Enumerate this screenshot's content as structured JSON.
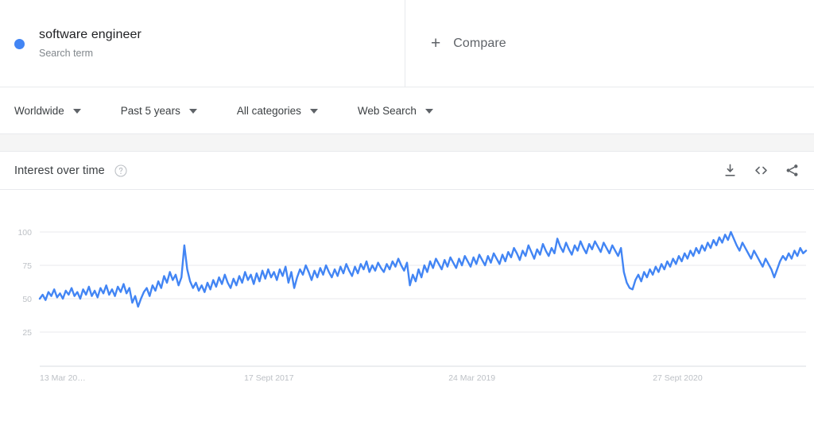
{
  "header": {
    "term": {
      "label": "software engineer",
      "sublabel": "Search term",
      "color": "#4285f4"
    },
    "compare": {
      "label": "Compare",
      "plus": "+"
    }
  },
  "filters": [
    {
      "label": "Worldwide"
    },
    {
      "label": "Past 5 years"
    },
    {
      "label": "All categories"
    },
    {
      "label": "Web Search"
    }
  ],
  "card": {
    "title": "Interest over time",
    "help_icon": "help-circle-icon",
    "actions": [
      {
        "name": "download-icon"
      },
      {
        "name": "embed-icon"
      },
      {
        "name": "share-icon"
      }
    ]
  },
  "chart_data": {
    "type": "line",
    "title": "Interest over time",
    "xlabel": "",
    "ylabel": "",
    "ylim": [
      0,
      100
    ],
    "yticks": [
      100,
      75,
      50,
      25
    ],
    "grid": true,
    "legend": [
      "software engineer"
    ],
    "legend_position": "top-left",
    "line_color": "#4285f4",
    "xtick_labels": [
      "13 Mar 20…",
      "17 Sept 2017",
      "24 Mar 2019",
      "27 Sept 2020"
    ],
    "xtick_positions": [
      0,
      0.2667,
      0.5334,
      0.8
    ],
    "series": [
      {
        "name": "software engineer",
        "values": [
          50,
          53,
          49,
          55,
          52,
          57,
          51,
          54,
          50,
          56,
          53,
          58,
          52,
          55,
          50,
          57,
          53,
          59,
          52,
          56,
          51,
          58,
          54,
          60,
          53,
          57,
          52,
          59,
          55,
          61,
          54,
          58,
          47,
          52,
          44,
          50,
          55,
          58,
          52,
          60,
          56,
          63,
          58,
          67,
          62,
          70,
          64,
          68,
          60,
          66,
          90,
          72,
          63,
          58,
          62,
          56,
          60,
          55,
          62,
          57,
          64,
          59,
          66,
          61,
          68,
          62,
          58,
          65,
          60,
          67,
          62,
          70,
          64,
          68,
          61,
          69,
          63,
          71,
          65,
          72,
          66,
          70,
          64,
          72,
          67,
          74,
          62,
          70,
          58,
          66,
          72,
          68,
          75,
          70,
          64,
          71,
          66,
          73,
          68,
          75,
          70,
          66,
          72,
          67,
          74,
          69,
          76,
          71,
          67,
          74,
          69,
          76,
          72,
          78,
          70,
          75,
          71,
          77,
          73,
          70,
          76,
          72,
          78,
          74,
          80,
          75,
          71,
          77,
          60,
          68,
          63,
          72,
          66,
          75,
          70,
          78,
          73,
          80,
          76,
          72,
          79,
          74,
          81,
          77,
          73,
          80,
          75,
          82,
          78,
          74,
          81,
          76,
          83,
          79,
          75,
          82,
          77,
          84,
          80,
          76,
          83,
          78,
          85,
          81,
          88,
          84,
          79,
          86,
          82,
          90,
          85,
          80,
          87,
          83,
          91,
          86,
          82,
          88,
          84,
          95,
          89,
          85,
          92,
          87,
          83,
          90,
          86,
          93,
          88,
          84,
          91,
          87,
          93,
          89,
          85,
          92,
          88,
          84,
          90,
          86,
          82,
          88,
          70,
          62,
          58,
          57,
          64,
          68,
          63,
          70,
          66,
          72,
          68,
          74,
          70,
          76,
          72,
          78,
          74,
          80,
          76,
          82,
          78,
          84,
          80,
          86,
          82,
          88,
          84,
          90,
          86,
          92,
          88,
          94,
          90,
          96,
          92,
          98,
          94,
          100,
          95,
          90,
          86,
          92,
          88,
          84,
          80,
          86,
          82,
          78,
          74,
          80,
          76,
          72,
          66,
          72,
          78,
          82,
          79,
          84,
          80,
          86,
          82,
          88,
          84,
          86
        ]
      }
    ]
  }
}
